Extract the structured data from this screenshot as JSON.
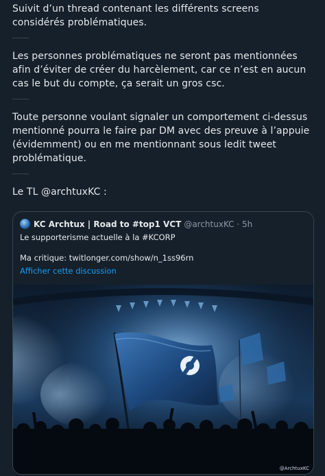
{
  "thread": {
    "paragraphs": [
      "Suivit d’un thread contenant les différents screens considérés problématiques.",
      "Les personnes problématiques ne seront pas mentionnées afin d’éviter de créer du harcèlement, car ce n’est en aucun cas le but du compte, ça serait un gros csc.",
      "Toute personne voulant signaler un comportement ci-dessus mentionné pourra le faire par DM avec des preuve à l’appuie (évidemment) ou en me mentionnant sous ledit tweet problématique.",
      "Le TL @archtuxKC :"
    ]
  },
  "quote": {
    "author_name": "KC Archtux | Road to #top1 VCT",
    "author_handle": "@archtuxKC · 5h",
    "text_line1": "Le supporterisme actuelle à la #KCORP",
    "text_line2": "Ma critique: twitlonger.com/show/n_1ss96rn",
    "show_thread": "Afficher cette discussion",
    "image_watermark": "@ArchtuxKC"
  },
  "colors": {
    "background": "#15202b",
    "text": "#e7e9ea",
    "muted": "#8b98a5",
    "link": "#1d9bf0",
    "border": "#38444d"
  }
}
